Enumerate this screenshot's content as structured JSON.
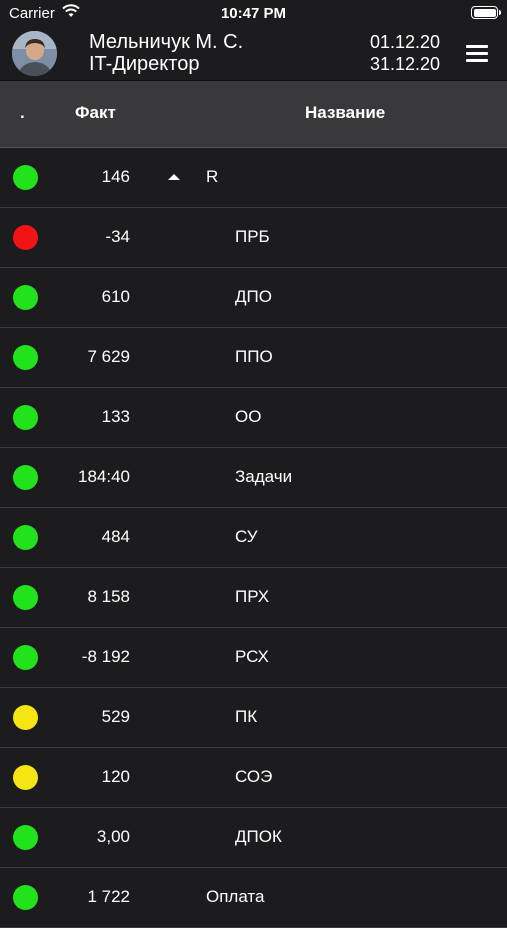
{
  "status_bar": {
    "carrier": "Carrier",
    "time": "10:47 PM"
  },
  "header": {
    "user_name": "Мельничук М. С.",
    "user_role": "IT-Директор",
    "date_from": "01.12.20",
    "date_to": "31.12.20"
  },
  "table": {
    "col_dot": ".",
    "col_fact": "Факт",
    "col_name": "Название",
    "rows": [
      {
        "status": "green",
        "value": "146",
        "name": "R"
      },
      {
        "status": "red",
        "value": "-34",
        "name": "ПРБ"
      },
      {
        "status": "green",
        "value": "610",
        "name": "ДПО"
      },
      {
        "status": "green",
        "value": "7 629",
        "name": "ППО"
      },
      {
        "status": "green",
        "value": "133",
        "name": "ОО"
      },
      {
        "status": "green",
        "value": "184:40",
        "name": "Задачи"
      },
      {
        "status": "green",
        "value": "484",
        "name": "СУ"
      },
      {
        "status": "green",
        "value": "8 158",
        "name": "ПРХ"
      },
      {
        "status": "green",
        "value": "-8 192",
        "name": "РСХ"
      },
      {
        "status": "yellow",
        "value": "529",
        "name": "ПК"
      },
      {
        "status": "yellow",
        "value": "120",
        "name": "СОЭ"
      },
      {
        "status": "green",
        "value": "3,00",
        "name": "ДПОК"
      },
      {
        "status": "green",
        "value": "1 722",
        "name": "Оплата"
      }
    ]
  },
  "colors": {
    "green": "#22e31b",
    "red": "#f21414",
    "yellow": "#f5e512"
  }
}
